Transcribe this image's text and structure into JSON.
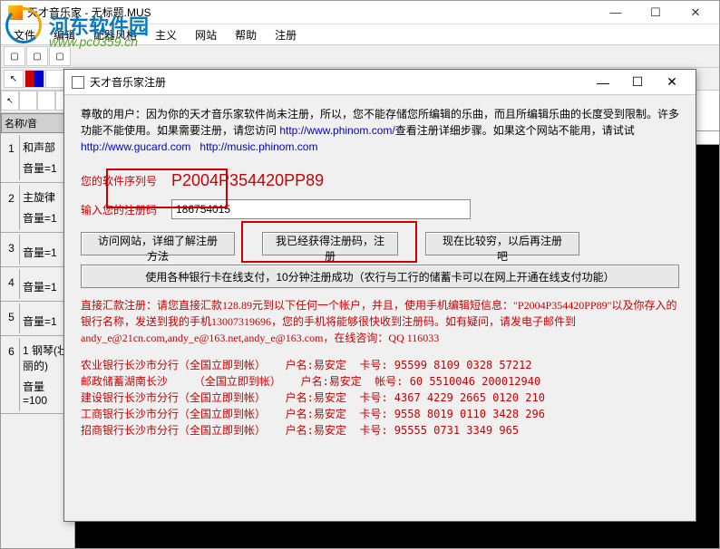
{
  "main_window": {
    "title": "天才音乐家 - 无标题.MUS",
    "min_label": "—",
    "max_label": "☐",
    "close_label": "✕"
  },
  "menu": {
    "items": [
      "文件",
      "编辑",
      "配器风格",
      "主义",
      "网站",
      "帮助",
      "注册"
    ]
  },
  "watermark": {
    "text": "河东软件园",
    "url": "www.pc0359.cn"
  },
  "tracks": {
    "header": "名称/音",
    "rows": [
      {
        "num": "1",
        "label1": "和声部",
        "label2": "音量=1"
      },
      {
        "num": "2",
        "label1": "主旋律",
        "label2": "音量=1"
      },
      {
        "num": "3",
        "label1": "",
        "label2": "音量=1"
      },
      {
        "num": "4",
        "label1": "",
        "label2": "音量=1"
      },
      {
        "num": "5",
        "label1": "",
        "label2": "音量=1"
      },
      {
        "num": "6",
        "label1": "1 钢琴(壮丽的)",
        "label2": "音量=100"
      }
    ]
  },
  "dialog": {
    "title": "天才音乐家注册",
    "min": "—",
    "max": "☐",
    "close": "✕",
    "notice_line1": "尊敬的用户：因为你的天才音乐家软件尚未注册，所以，您不能存储您所编辑的乐曲，而且所编辑乐曲的长度受到限制。许多功能不能使用。如果需要注册，请您访问 ",
    "notice_url1": "http://www.phinom.com/",
    "notice_line2": "查看注册详细步骤。如果这个网站不能用，请试试",
    "notice_url2": "http://www.gucard.com",
    "notice_url3": "http://music.phinom.com",
    "serial_label": "您的软件序列号",
    "serial_value": "P2004P354420PP89",
    "code_label": "输入您的注册码",
    "code_value": "186754015",
    "btn_visit": "访问网站，详细了解注册方法",
    "btn_register": "我已经获得注册码，注册",
    "btn_later": "现在比较穷，以后再注册吧",
    "btn_pay": "使用各种银行卡在线支付，10分钟注册成功（农行与工行的储蓄卡可以在网上开通在线支付功能）",
    "remit_text": "直接汇款注册：请您直接汇款128.89元到以下任何一个帐户，并且，使用手机编辑短信息：\"P2004P354420PP89\"以及你存入的银行名称，发送到我的手机13007319696，您的手机将能够很快收到注册码。如有疑问，请发电子邮件到andy_e@21cn.com,andy_e@163.net,andy_e@163.com，在线咨询：QQ 116033",
    "bank_info": "农业银行长沙市分行（全国立即到帐）   户名:易安定  卡号: 95599 8109 0328 57212\n邮政储蓄湖南长沙    （全国立即到帐）   户名:易安定  帐号: 60 5510046 200012940\n建设银行长沙市分行（全国立即到帐）   户名:易安定  卡号: 4367 4229 2665 0120 210\n工商银行长沙市分行（全国立即到帐）   户名:易安定  卡号: 9558 8019 0110 3428 296\n招商银行长沙市分行（全国立即到帐）   户名:易安定  卡号: 95555 0731 3349 965"
  }
}
